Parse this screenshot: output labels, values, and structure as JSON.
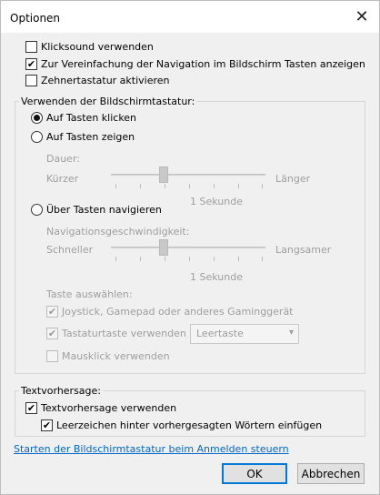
{
  "window": {
    "title": "Optionen"
  },
  "top_options": [
    {
      "label": "Klicksound verwenden",
      "checked": false
    },
    {
      "label": "Zur Vereinfachung der Navigation im Bildschirm Tasten anzeigen",
      "checked": true
    },
    {
      "label": "Zehnertastatur aktivieren",
      "checked": false
    }
  ],
  "usage_group": {
    "legend": "Verwenden der Bildschirmtastatur:",
    "radio_click": "Auf Tasten klicken",
    "radio_hover": "Auf Tasten zeigen",
    "dwell_label": "Dauer:",
    "dwell_min": "Kürzer",
    "dwell_max": "Länger",
    "dwell_value": "1 Sekunde",
    "radio_scan": "Über Tasten navigieren",
    "scan_label": "Navigationsgeschwindigkeit:",
    "scan_min": "Schneller",
    "scan_max": "Langsamer",
    "scan_value": "1 Sekunde",
    "select_keys_label": "Taste auswählen:",
    "joystick": "Joystick, Gamepad oder anderes Gaminggerät",
    "keyboard_key": "Tastaturtaste verwenden",
    "keyboard_key_option": "Leertaste",
    "mouse_click": "Mausklick verwenden"
  },
  "prediction_group": {
    "legend": "Textvorhersage:",
    "use_prediction": "Textvorhersage verwenden",
    "insert_space": "Leerzeichen hinter vorhergesagten Wörtern einfügen"
  },
  "link": "Starten der Bildschirmtastatur beim Anmelden steuern",
  "buttons": {
    "ok": "OK",
    "cancel": "Abbrechen"
  }
}
